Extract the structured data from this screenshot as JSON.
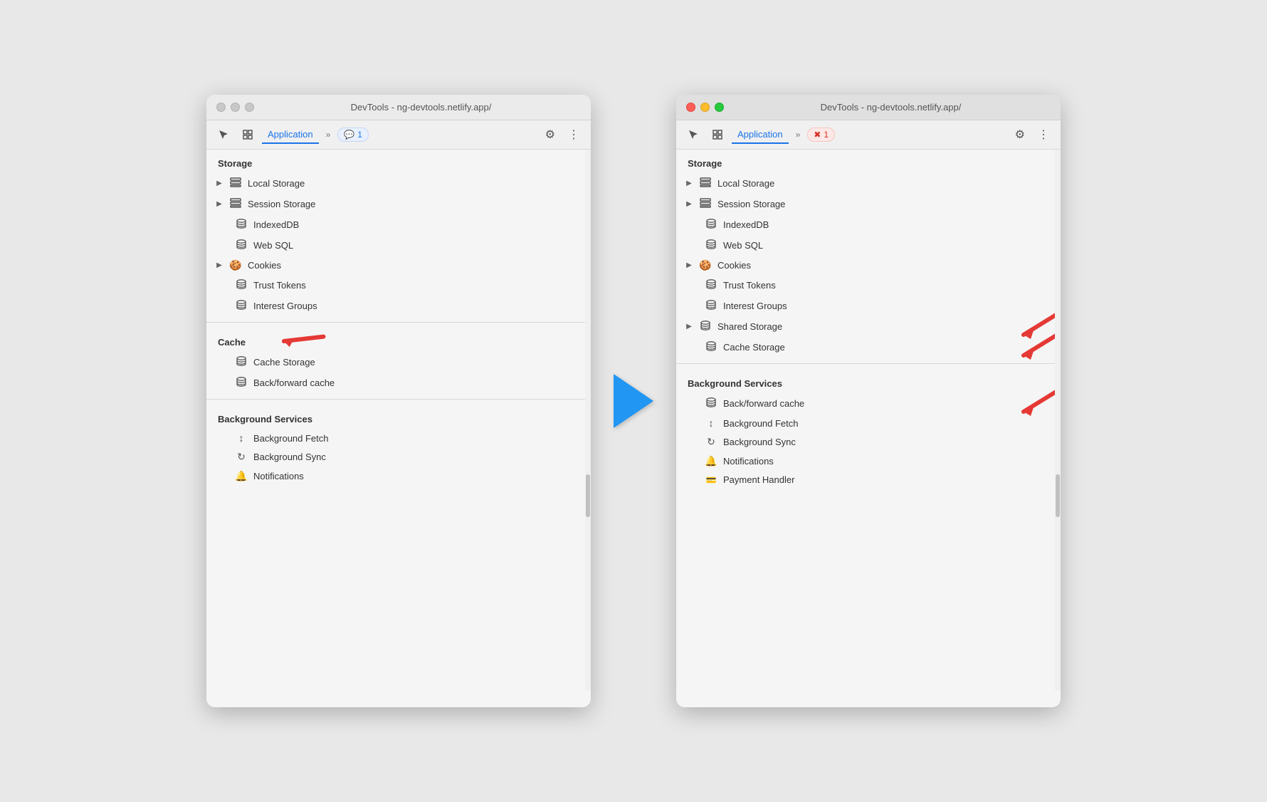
{
  "left_window": {
    "title": "DevTools - ng-devtools.netlify.app/",
    "tab": "Application",
    "badge": "1",
    "badge_type": "message",
    "storage_header": "Storage",
    "storage_items": [
      {
        "label": "Local Storage",
        "icon": "grid",
        "expandable": true
      },
      {
        "label": "Session Storage",
        "icon": "grid",
        "expandable": true
      },
      {
        "label": "IndexedDB",
        "icon": "db"
      },
      {
        "label": "Web SQL",
        "icon": "db"
      },
      {
        "label": "Cookies",
        "icon": "cookie",
        "expandable": true
      },
      {
        "label": "Trust Tokens",
        "icon": "db"
      },
      {
        "label": "Interest Groups",
        "icon": "db"
      }
    ],
    "cache_header": "Cache",
    "cache_items": [
      {
        "label": "Cache Storage",
        "icon": "db"
      },
      {
        "label": "Back/forward cache",
        "icon": "db"
      }
    ],
    "bg_header": "Background Services",
    "bg_items": [
      {
        "label": "Background Fetch",
        "icon": "arrows"
      },
      {
        "label": "Background Sync",
        "icon": "sync"
      },
      {
        "label": "Notifications",
        "icon": "bell"
      }
    ],
    "annotations": {
      "cache_arrow": true
    }
  },
  "right_window": {
    "title": "DevTools - ng-devtools.netlify.app/",
    "tab": "Application",
    "badge": "1",
    "badge_type": "error",
    "storage_header": "Storage",
    "storage_items": [
      {
        "label": "Local Storage",
        "icon": "grid",
        "expandable": true
      },
      {
        "label": "Session Storage",
        "icon": "grid",
        "expandable": true
      },
      {
        "label": "IndexedDB",
        "icon": "db"
      },
      {
        "label": "Web SQL",
        "icon": "db"
      },
      {
        "label": "Cookies",
        "icon": "cookie",
        "expandable": true
      },
      {
        "label": "Trust Tokens",
        "icon": "db"
      },
      {
        "label": "Interest Groups",
        "icon": "db"
      },
      {
        "label": "Shared Storage",
        "icon": "db",
        "expandable": true
      },
      {
        "label": "Cache Storage",
        "icon": "db"
      }
    ],
    "bg_header": "Background Services",
    "bg_items": [
      {
        "label": "Back/forward cache",
        "icon": "db"
      },
      {
        "label": "Background Fetch",
        "icon": "arrows"
      },
      {
        "label": "Background Sync",
        "icon": "sync"
      },
      {
        "label": "Notifications",
        "icon": "bell"
      },
      {
        "label": "Payment Handler",
        "icon": "card"
      }
    ],
    "annotations": {
      "interest_groups_arrow": true,
      "shared_storage_arrow": true,
      "cache_storage_arrow": true,
      "back_forward_arrow": true
    }
  }
}
